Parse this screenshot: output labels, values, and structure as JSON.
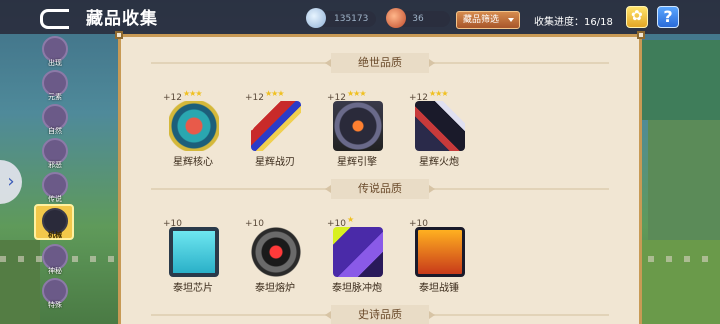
{
  "header": {
    "title": "藏品收集",
    "gem_count": "135173",
    "ore_count": "36",
    "filter_label": "藏品筛选",
    "progress_label": "收集进度：16/18"
  },
  "rail": {
    "items": [
      {
        "label": "出现"
      },
      {
        "label": "元素"
      },
      {
        "label": "自然"
      },
      {
        "label": "邪恶"
      },
      {
        "label": "机械"
      },
      {
        "label": "传说"
      },
      {
        "label": "神秘"
      },
      {
        "label": "特殊"
      }
    ],
    "active_index": 4
  },
  "sections": [
    {
      "title": "绝世品质",
      "items": [
        {
          "name": "星辉核心",
          "plus": "+12",
          "stars": 3
        },
        {
          "name": "星辉战刃",
          "plus": "+12",
          "stars": 3
        },
        {
          "name": "星辉引擎",
          "plus": "+12",
          "stars": 3
        },
        {
          "name": "星辉火炮",
          "plus": "+12",
          "stars": 3
        }
      ]
    },
    {
      "title": "传说品质",
      "items": [
        {
          "name": "泰坦芯片",
          "plus": "+10",
          "stars": 0
        },
        {
          "name": "泰坦熔炉",
          "plus": "+10",
          "stars": 0
        },
        {
          "name": "泰坦脉冲炮",
          "plus": "+10",
          "stars": 1
        },
        {
          "name": "泰坦战锤",
          "plus": "+10",
          "stars": 0
        }
      ]
    },
    {
      "title": "史诗品质",
      "items": []
    }
  ],
  "icons": {
    "back": "back-arrow-icon",
    "gem": "gem-icon",
    "ore": "ore-icon",
    "lotus": "lotus-icon",
    "help": "help-icon",
    "expand": "chevron-right-icon"
  }
}
